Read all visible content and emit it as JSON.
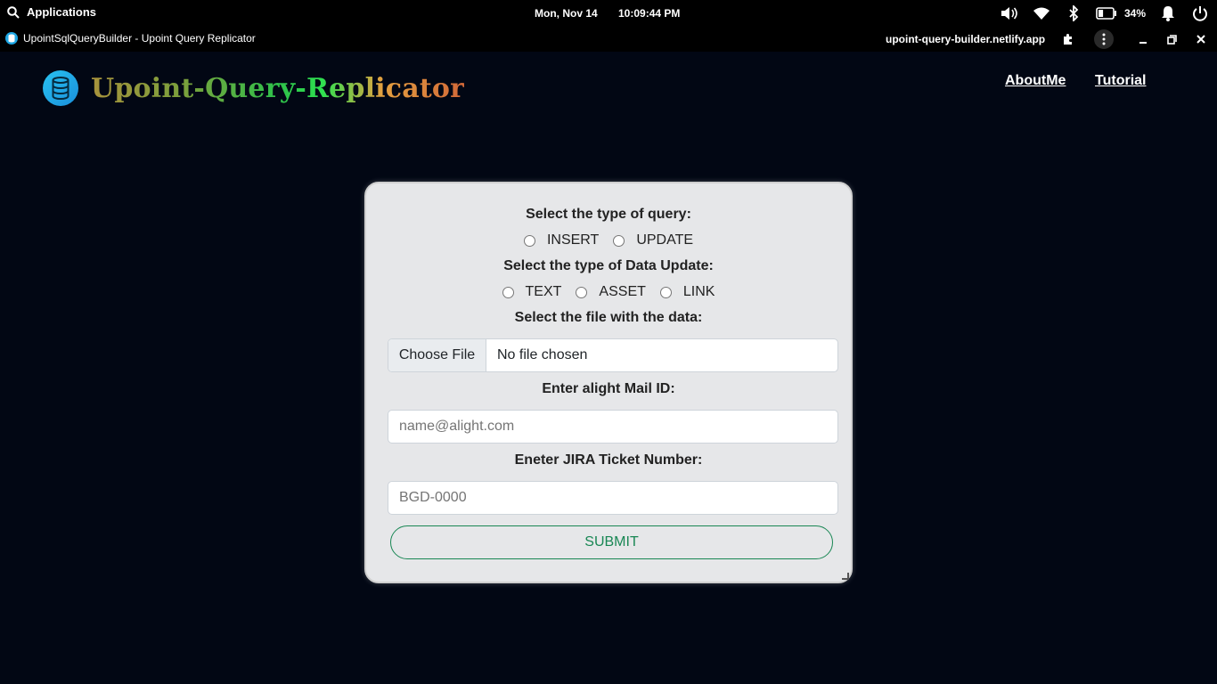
{
  "os": {
    "applications_label": "Applications",
    "date": "Mon, Nov 14",
    "time": "10:09:44 PM",
    "battery_percent": "34%",
    "battery_level": 0.34
  },
  "window": {
    "title": "UpointSqlQueryBuilder - Upoint Query Replicator",
    "url": "upoint-query-builder.netlify.app"
  },
  "header": {
    "brand": "Upoint-Query-Replicator",
    "nav": [
      "AboutMe",
      "Tutorial"
    ]
  },
  "form": {
    "query_type_label": "Select the type of query:",
    "query_types": [
      "INSERT",
      "UPDATE"
    ],
    "data_update_label": "Select the type of Data Update:",
    "data_update_types": [
      "TEXT",
      "ASSET",
      "LINK"
    ],
    "file_label": "Select the file with the data:",
    "file_button": "Choose File",
    "file_status": "No file chosen",
    "mail_label": "Enter alight Mail ID:",
    "mail_placeholder": "name@alight.com",
    "jira_label": "Eneter JIRA Ticket Number:",
    "jira_placeholder": "BGD-0000",
    "submit_label": "SUBMIT"
  },
  "colors": {
    "page_bg": "#020714",
    "card_bg": "#e6e7e9",
    "submit_accent": "#198754",
    "logo_accent": "#1ea7e4"
  }
}
